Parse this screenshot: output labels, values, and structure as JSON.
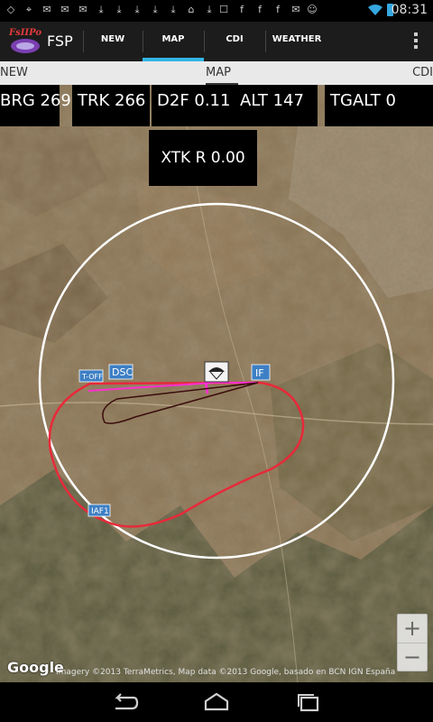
{
  "status_bar": {
    "time": "08:31"
  },
  "action_bar": {
    "app_name": "FSP",
    "logo_text": "FsIIPo",
    "tabs": [
      {
        "label": "NEW",
        "selected": false
      },
      {
        "label": "MAP",
        "selected": true
      },
      {
        "label": "CDI",
        "selected": false
      },
      {
        "label": "WEATHER",
        "selected": false
      }
    ]
  },
  "tab_strip": {
    "left": "NEW",
    "center": "MAP",
    "right": "CDI"
  },
  "data_boxes": {
    "brg": "BRG 269",
    "trk": "TRK 266",
    "d2f": "D2F 0.11",
    "alt": "ALT 147",
    "tgalt": "TGALT 0",
    "xtk": "XTK R 0.00"
  },
  "map": {
    "waypoints": {
      "toff": "T-OFF",
      "dsc": "DSC",
      "if": "IF",
      "iaf1": "IAF1"
    },
    "zoom_in": "+",
    "zoom_out": "−",
    "google": "Google",
    "attribution": "Imagery ©2013 TerraMetrics, Map data ©2013 Google, basado en BCN IGN España"
  },
  "colors": {
    "accent": "#33b5e5",
    "route": "#e8293a",
    "track": "#ff2fd0",
    "circle": "#ffffff"
  }
}
